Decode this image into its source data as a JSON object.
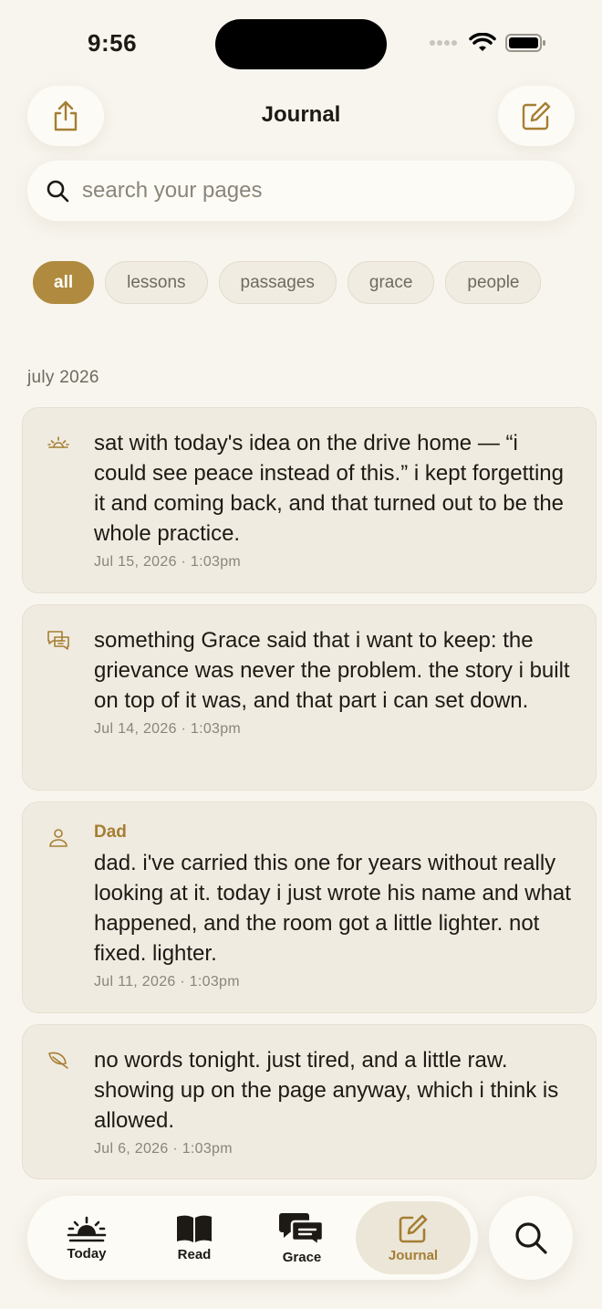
{
  "status_bar": {
    "time": "9:56"
  },
  "header": {
    "title": "Journal",
    "share_icon": "share-icon",
    "compose_icon": "compose-icon"
  },
  "search": {
    "placeholder": "search your pages"
  },
  "filters": [
    {
      "label": "all",
      "active": true
    },
    {
      "label": "lessons",
      "active": false
    },
    {
      "label": "passages",
      "active": false
    },
    {
      "label": "grace",
      "active": false
    },
    {
      "label": "people",
      "active": false
    }
  ],
  "section": {
    "label": "july 2026"
  },
  "entries": [
    {
      "icon": "sunrise-icon",
      "person": "",
      "text": "sat with today's idea on the drive home — “i could see peace instead of this.” i kept forgetting it and coming back, and that turned out to be the whole practice.",
      "date": "Jul 15, 2026 · 1:03pm"
    },
    {
      "icon": "chat-bubbles-icon",
      "person": "",
      "text": "something Grace said that i want to keep: the grievance was never the problem. the story i built on top of it was, and that part i can set down.",
      "date": "Jul 14, 2026 · 1:03pm"
    },
    {
      "icon": "person-icon",
      "person": "Dad",
      "text": "dad. i've carried this one for years without really looking at it. today i just wrote his name and what happened, and the room got a little lighter. not fixed. lighter.",
      "date": "Jul 11, 2026 · 1:03pm"
    },
    {
      "icon": "leaf-icon",
      "person": "",
      "text": "no words tonight. just tired, and a little raw. showing up on the page anyway, which i think is allowed.",
      "date": "Jul 6, 2026 · 1:03pm"
    }
  ],
  "tabbar": {
    "tabs": [
      {
        "label": "Today",
        "icon": "sunrise-icon",
        "active": false
      },
      {
        "label": "Read",
        "icon": "book-icon",
        "active": false
      },
      {
        "label": "Grace",
        "icon": "chat-bubbles-icon",
        "active": false
      },
      {
        "label": "Journal",
        "icon": "compose-icon",
        "active": true
      }
    ],
    "search_icon": "search-icon"
  },
  "colors": {
    "accent": "#b08a3e",
    "background": "#f8f5ee",
    "card": "#f0ebe0"
  }
}
